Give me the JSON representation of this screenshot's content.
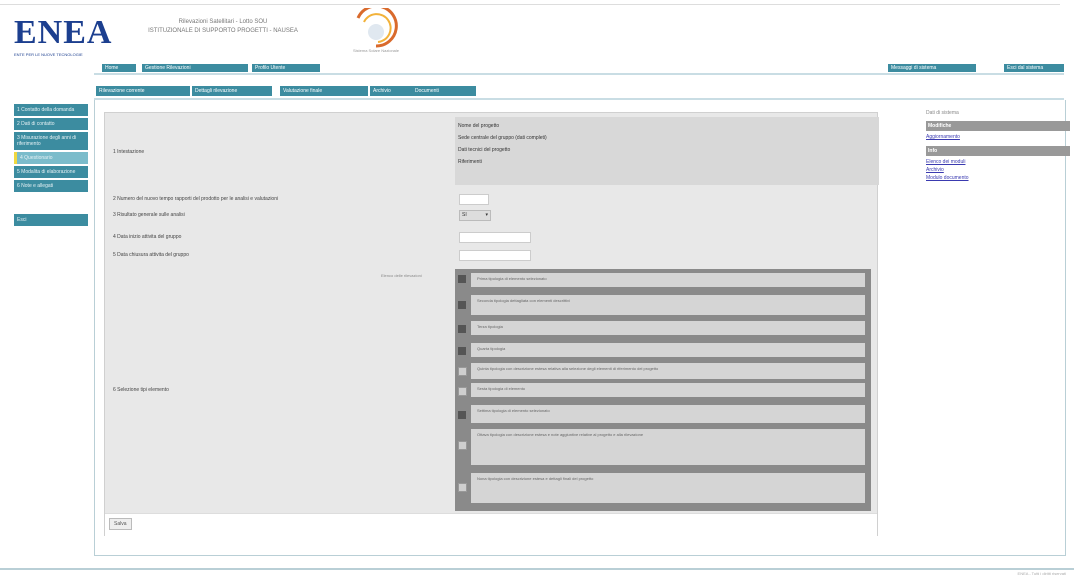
{
  "header": {
    "logo_text": "ENEA",
    "logo_sub": "ENTE PER LE NUOVE TECNOLOGIE",
    "project_line1": "Rilevazioni Satellitari - Lotto SOU",
    "project_line2": "ISTITUZIONALE DI SUPPORTO PROGETTI - NAUSEA",
    "emblem_caption": "Sistema Solare Nazionale"
  },
  "nav": {
    "items": [
      "Home",
      "Gestione Rilevazioni",
      "Profilo Utente"
    ],
    "right_items": [
      "Messaggi di sistema",
      "Esci dal sistema"
    ]
  },
  "subnav": {
    "items": [
      "Rilevazione corrente",
      "Dettagli rilevazione",
      "Valutazione finale",
      "Archivio",
      "Documenti"
    ]
  },
  "sidebar": {
    "items": [
      "1 Contatto della domanda",
      "2 Dati di contatto",
      "3 Misurazione degli anni di riferimento",
      "4 Questionario",
      "5 Modalita di elaborazione",
      "6 Note e allegati"
    ],
    "bottom": "Esci"
  },
  "form": {
    "q1_label": "1 Intestazione",
    "q1_right": [
      "Nome del progetto",
      "Sede centrale del gruppo (dati completi)",
      "Dati tecnici del progetto",
      "Riferimenti"
    ],
    "q2_label": "2 Numero del nuovo tempo rapporti del prodotto per le analisi e valutazioni",
    "q3_label": "3 Risultato generale sulle analisi",
    "q3_select": "SI",
    "q4_label": "4 Data inizio attivita del gruppo",
    "q5_label": "5 Data chiusura attivita del gruppo",
    "list_caption": "Elenco delle rilevazioni",
    "q6_label": "6 Selezione tipi elemento",
    "list_items": [
      "Prima tipologia di elemento selezionato",
      "Seconda tipologia dettagliata con elementi descrittivi",
      "Terza tipologia",
      "Quarta tipologia",
      "Quinta tipologia con descrizione estesa relativa alla selezione degli elementi di riferimento del progetto",
      "Sesta tipologia di elemento",
      "Settima tipologia di elemento selezionato",
      "Ottava tipologia con descrizione estesa e note aggiuntive relative al progetto e alla rilevazione",
      "Nona tipologia con descrizione estesa e dettagli finali del progetto"
    ],
    "save_label": "Salva"
  },
  "right": {
    "heading": "Dati di sistema",
    "bar1": "Modifiche",
    "link1": "Aggiornamento",
    "bar2": "Info",
    "links": [
      "Elenco dei moduli",
      "Archivio",
      "Modulo documento"
    ]
  },
  "footer": {
    "copyright": "ENEA - Tutti i diritti riservati"
  }
}
